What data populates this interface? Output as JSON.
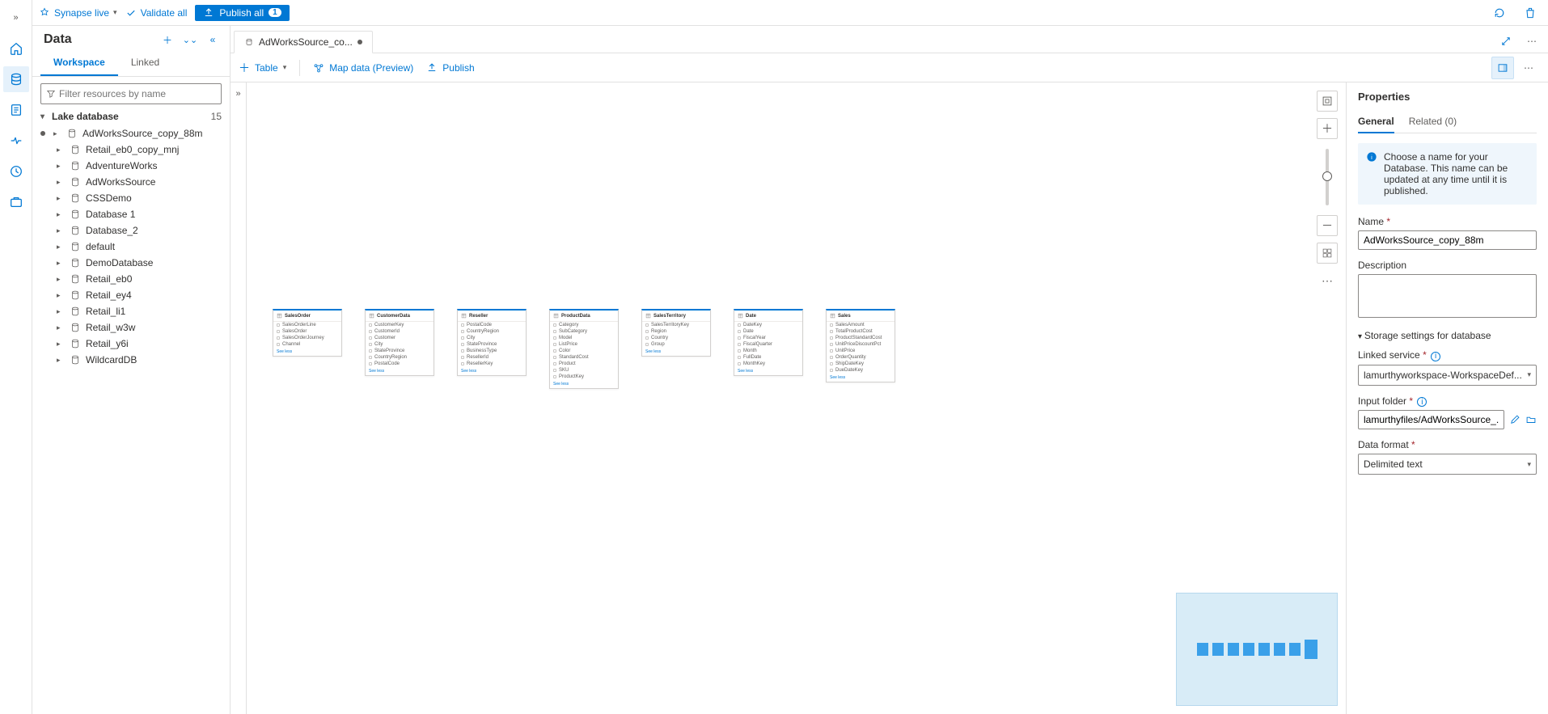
{
  "cmdbar": {
    "live": "Synapse live",
    "validate": "Validate all",
    "publish": "Publish all",
    "publish_badge": "1"
  },
  "sidebar": {
    "title": "Data",
    "tabs": {
      "workspace": "Workspace",
      "linked": "Linked"
    },
    "filter_placeholder": "Filter resources by name",
    "group": {
      "label": "Lake database",
      "count": "15"
    },
    "items": [
      {
        "label": "AdWorksSource_copy_88m",
        "dirty": true
      },
      {
        "label": "Retail_eb0_copy_mnj"
      },
      {
        "label": "AdventureWorks"
      },
      {
        "label": "AdWorksSource"
      },
      {
        "label": "CSSDemo"
      },
      {
        "label": "Database 1"
      },
      {
        "label": "Database_2"
      },
      {
        "label": "default"
      },
      {
        "label": "DemoDatabase"
      },
      {
        "label": "Retail_eb0"
      },
      {
        "label": "Retail_ey4"
      },
      {
        "label": "Retail_li1"
      },
      {
        "label": "Retail_w3w"
      },
      {
        "label": "Retail_y6i"
      },
      {
        "label": "WildcardDB"
      }
    ]
  },
  "tab": {
    "label": "AdWorksSource_co..."
  },
  "ed_toolbar": {
    "table": "Table",
    "map_data": "Map data (Preview)",
    "publish": "Publish"
  },
  "tables": [
    {
      "name": "SalesOrder",
      "cols": [
        "SalesOrderLine",
        "SalesOrder",
        "SalesOrderJourney",
        "Channel"
      ]
    },
    {
      "name": "CustomerData",
      "cols": [
        "CustomerKey",
        "CustomerId",
        "Customer",
        "City",
        "StateProvince",
        "CountryRegion",
        "PostalCode"
      ]
    },
    {
      "name": "Reseller",
      "cols": [
        "PostalCode",
        "CountryRegion",
        "City",
        "StateProvince",
        "BusinessType",
        "ResellerId",
        "ResellerKey"
      ]
    },
    {
      "name": "ProductData",
      "cols": [
        "Category",
        "SubCategory",
        "Model",
        "ListPrice",
        "Color",
        "StandardCost",
        "Product",
        "SKU",
        "ProductKey"
      ]
    },
    {
      "name": "SalesTerritory",
      "cols": [
        "SalesTerritoryKey",
        "Region",
        "Country",
        "Group"
      ]
    },
    {
      "name": "Date",
      "cols": [
        "DateKey",
        "Date",
        "FiscalYear",
        "FiscalQuarter",
        "Month",
        "FullDate",
        "MonthKey"
      ]
    },
    {
      "name": "Sales",
      "cols": [
        "SalesAmount",
        "TotalProductCost",
        "ProductStandardCost",
        "UnitPriceDiscountPct",
        "UnitPrice",
        "OrderQuantity",
        "ShipDateKey",
        "DueDateKey"
      ]
    }
  ],
  "see_more": "See less",
  "props": {
    "title": "Properties",
    "tabs": {
      "general": "General",
      "related": "Related (0)"
    },
    "info": "Choose a name for your Database. This name can be updated at any time until it is published.",
    "name_label": "Name",
    "name_value": "AdWorksSource_copy_88m",
    "desc_label": "Description",
    "desc_value": "",
    "storage_section": "Storage settings for database",
    "linked_label": "Linked service",
    "linked_value": "lamurthyworkspace-WorkspaceDef...",
    "input_label": "Input folder",
    "input_value": "lamurthyfiles/AdWorksSource_...",
    "format_label": "Data format",
    "format_value": "Delimited text"
  }
}
